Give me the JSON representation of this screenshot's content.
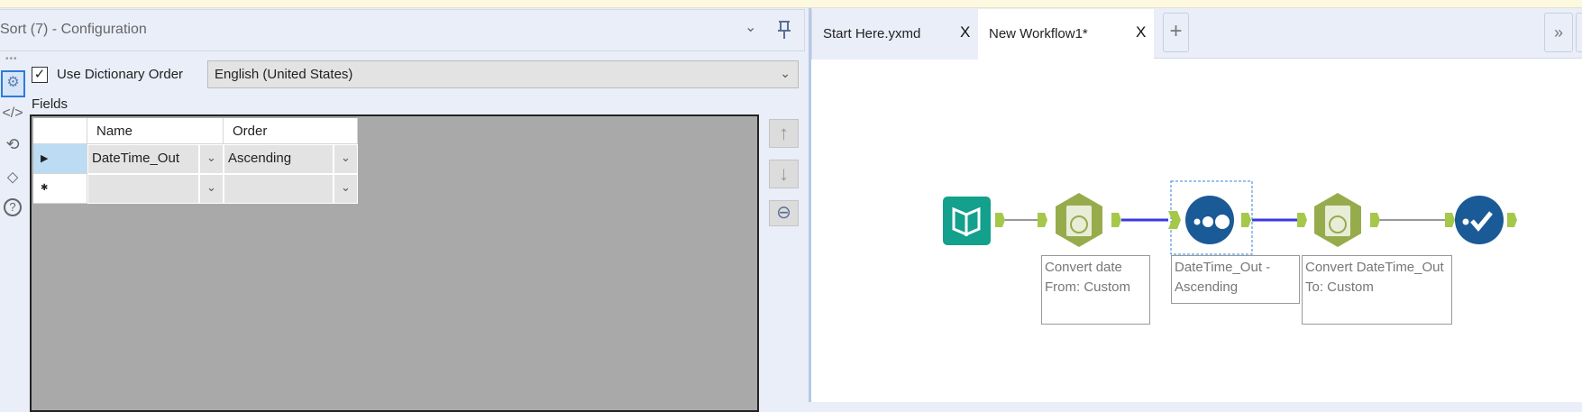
{
  "config": {
    "title": "Sort (7) - Configuration",
    "use_dictionary_order_label": "Use Dictionary Order",
    "use_dictionary_order_checked": true,
    "dictionary_language": "English (United States)",
    "fields_label": "Fields",
    "columns": [
      "Name",
      "Order"
    ],
    "rows": [
      {
        "name": "DateTime_Out",
        "order": "Ascending",
        "marker": "▶"
      },
      {
        "name": "",
        "order": "",
        "marker": "✱"
      }
    ],
    "check_mark": "✓"
  },
  "tabs": [
    {
      "label": "Start Here.yxmd",
      "close": "X",
      "active": false
    },
    {
      "label": "New Workflow1*",
      "close": "X",
      "active": true
    }
  ],
  "add_tab": "+",
  "more_tabs": "»",
  "workflow": {
    "nodes": [
      {
        "type": "input",
        "color": "#13a08c"
      },
      {
        "type": "datetime",
        "label": "Convert date From: Custom",
        "color": "#96ac4c"
      },
      {
        "type": "sort",
        "label": "DateTime_Out - Ascending",
        "color": "#1a5a96"
      },
      {
        "type": "datetime",
        "label": "Convert DateTime_Out To: Custom",
        "color": "#96ac4c"
      },
      {
        "type": "browse",
        "color": "#1a5a96"
      }
    ]
  }
}
